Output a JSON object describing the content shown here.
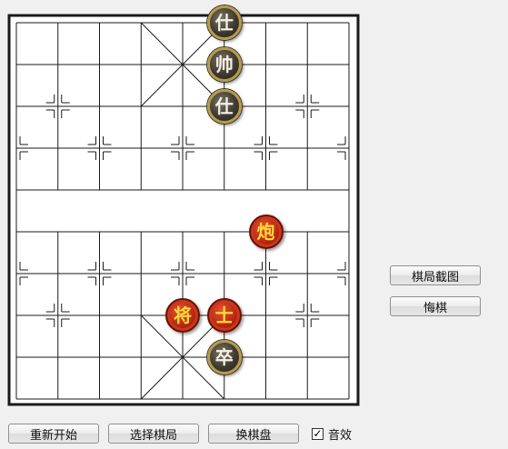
{
  "board": {
    "line_color": "#1a1a1a",
    "background": "#ffffff"
  },
  "pieces": [
    {
      "char": "仕",
      "side": "dark",
      "file": 5,
      "rank": 0
    },
    {
      "char": "帅",
      "side": "dark",
      "file": 5,
      "rank": 1
    },
    {
      "char": "仕",
      "side": "dark",
      "file": 5,
      "rank": 2
    },
    {
      "char": "炮",
      "side": "red",
      "file": 6,
      "rank": 5
    },
    {
      "char": "将",
      "side": "red",
      "file": 4,
      "rank": 7
    },
    {
      "char": "士",
      "side": "red",
      "file": 5,
      "rank": 7
    },
    {
      "char": "卒",
      "side": "dark",
      "file": 5,
      "rank": 8
    }
  ],
  "side_buttons": {
    "screenshot_label": "棋局截图",
    "undo_label": "悔棋"
  },
  "bottom_bar": {
    "restart_label": "重新开始",
    "choose_label": "选择棋局",
    "switch_board_label": "换棋盘",
    "sound_label": "音效",
    "sound_checked": true,
    "check_mark": "✓"
  }
}
